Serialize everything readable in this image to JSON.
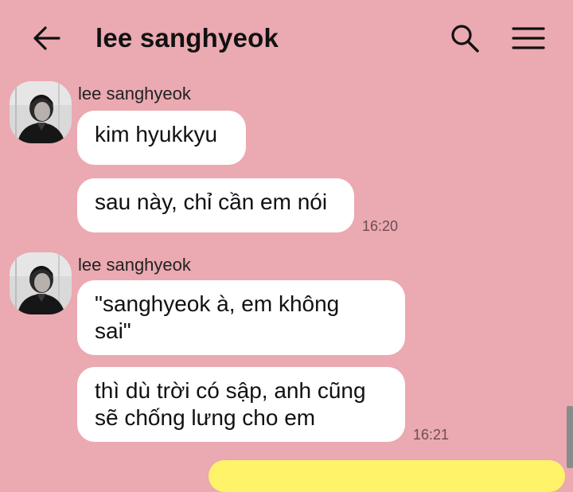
{
  "header": {
    "title": "lee sanghyeok",
    "back_icon": "arrow-left-icon",
    "search_icon": "search-icon",
    "menu_icon": "hamburger-menu-icon"
  },
  "messages": [
    {
      "sender": "lee sanghyeok",
      "bubbles": [
        "kim hyukkyu",
        "sau này, chỉ cần em nói"
      ],
      "time": "16:20"
    },
    {
      "sender": "lee sanghyeok",
      "bubbles": [
        "\"sanghyeok à, em không\nsai\"",
        "thì dù trời có sập, anh cũng\nsẽ chống lưng cho em"
      ],
      "time": "16:21"
    }
  ],
  "colors": {
    "background": "#eba9b1",
    "bubble": "#ffffff",
    "my_bubble": "#fff36a"
  }
}
